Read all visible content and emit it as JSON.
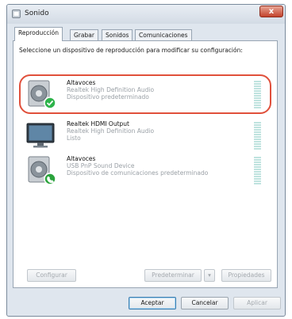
{
  "window": {
    "title": "Sonido",
    "close_label": "x"
  },
  "tabs": [
    {
      "label": "Reproducción",
      "active": true
    },
    {
      "label": "Grabar",
      "active": false
    },
    {
      "label": "Sonidos",
      "active": false
    },
    {
      "label": "Comunicaciones",
      "active": false
    }
  ],
  "instruction": "Seleccione un dispositivo de reproducción para modificar su configuración:",
  "devices": [
    {
      "name": "Altavoces",
      "driver": "Realtek High Definition Audio",
      "status": "Dispositivo predeterminado",
      "icon": "speaker-icon",
      "badge": "default-check-icon",
      "selected": true
    },
    {
      "name": "Realtek HDMI Output",
      "driver": "Realtek High Definition Audio",
      "status": "Listo",
      "icon": "monitor-icon",
      "badge": ""
    },
    {
      "name": "Altavoces",
      "driver": "USB PnP Sound Device",
      "status": "Dispositivo de comunicaciones predeterminado",
      "icon": "speaker-icon",
      "badge": "communications-phone-icon"
    }
  ],
  "buttons": {
    "configure": "Configurar",
    "set_default": "Predeterminar",
    "set_default_arrow": "▾",
    "properties": "Propiedades",
    "accept": "Aceptar",
    "cancel": "Cancelar",
    "apply": "Aplicar"
  },
  "colors": {
    "highlight": "#e0503b",
    "check_badge": "#2db34a",
    "phone_badge": "#2aa33c"
  }
}
